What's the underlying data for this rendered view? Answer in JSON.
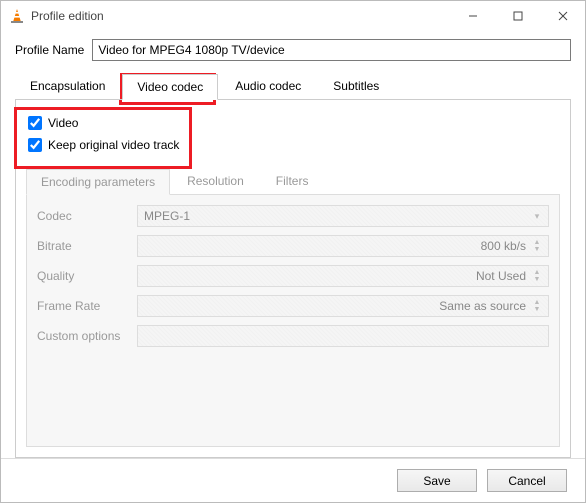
{
  "window": {
    "title": "Profile edition"
  },
  "profile": {
    "label": "Profile Name",
    "value": "Video for MPEG4 1080p TV/device"
  },
  "tabs": {
    "encapsulation": "Encapsulation",
    "video_codec": "Video codec",
    "audio_codec": "Audio codec",
    "subtitles": "Subtitles"
  },
  "video_codec_panel": {
    "video_checkbox": {
      "label": "Video",
      "checked": true
    },
    "keep_original_checkbox": {
      "label": "Keep original video track",
      "checked": true
    },
    "subtabs": {
      "encoding": "Encoding parameters",
      "resolution": "Resolution",
      "filters": "Filters"
    },
    "fields": {
      "codec": {
        "label": "Codec",
        "value": "MPEG-1"
      },
      "bitrate": {
        "label": "Bitrate",
        "value": "800 kb/s"
      },
      "quality": {
        "label": "Quality",
        "value": "Not Used"
      },
      "frame_rate": {
        "label": "Frame Rate",
        "value": "Same as source"
      },
      "custom_options": {
        "label": "Custom options",
        "value": ""
      }
    }
  },
  "buttons": {
    "save": "Save",
    "cancel": "Cancel"
  }
}
